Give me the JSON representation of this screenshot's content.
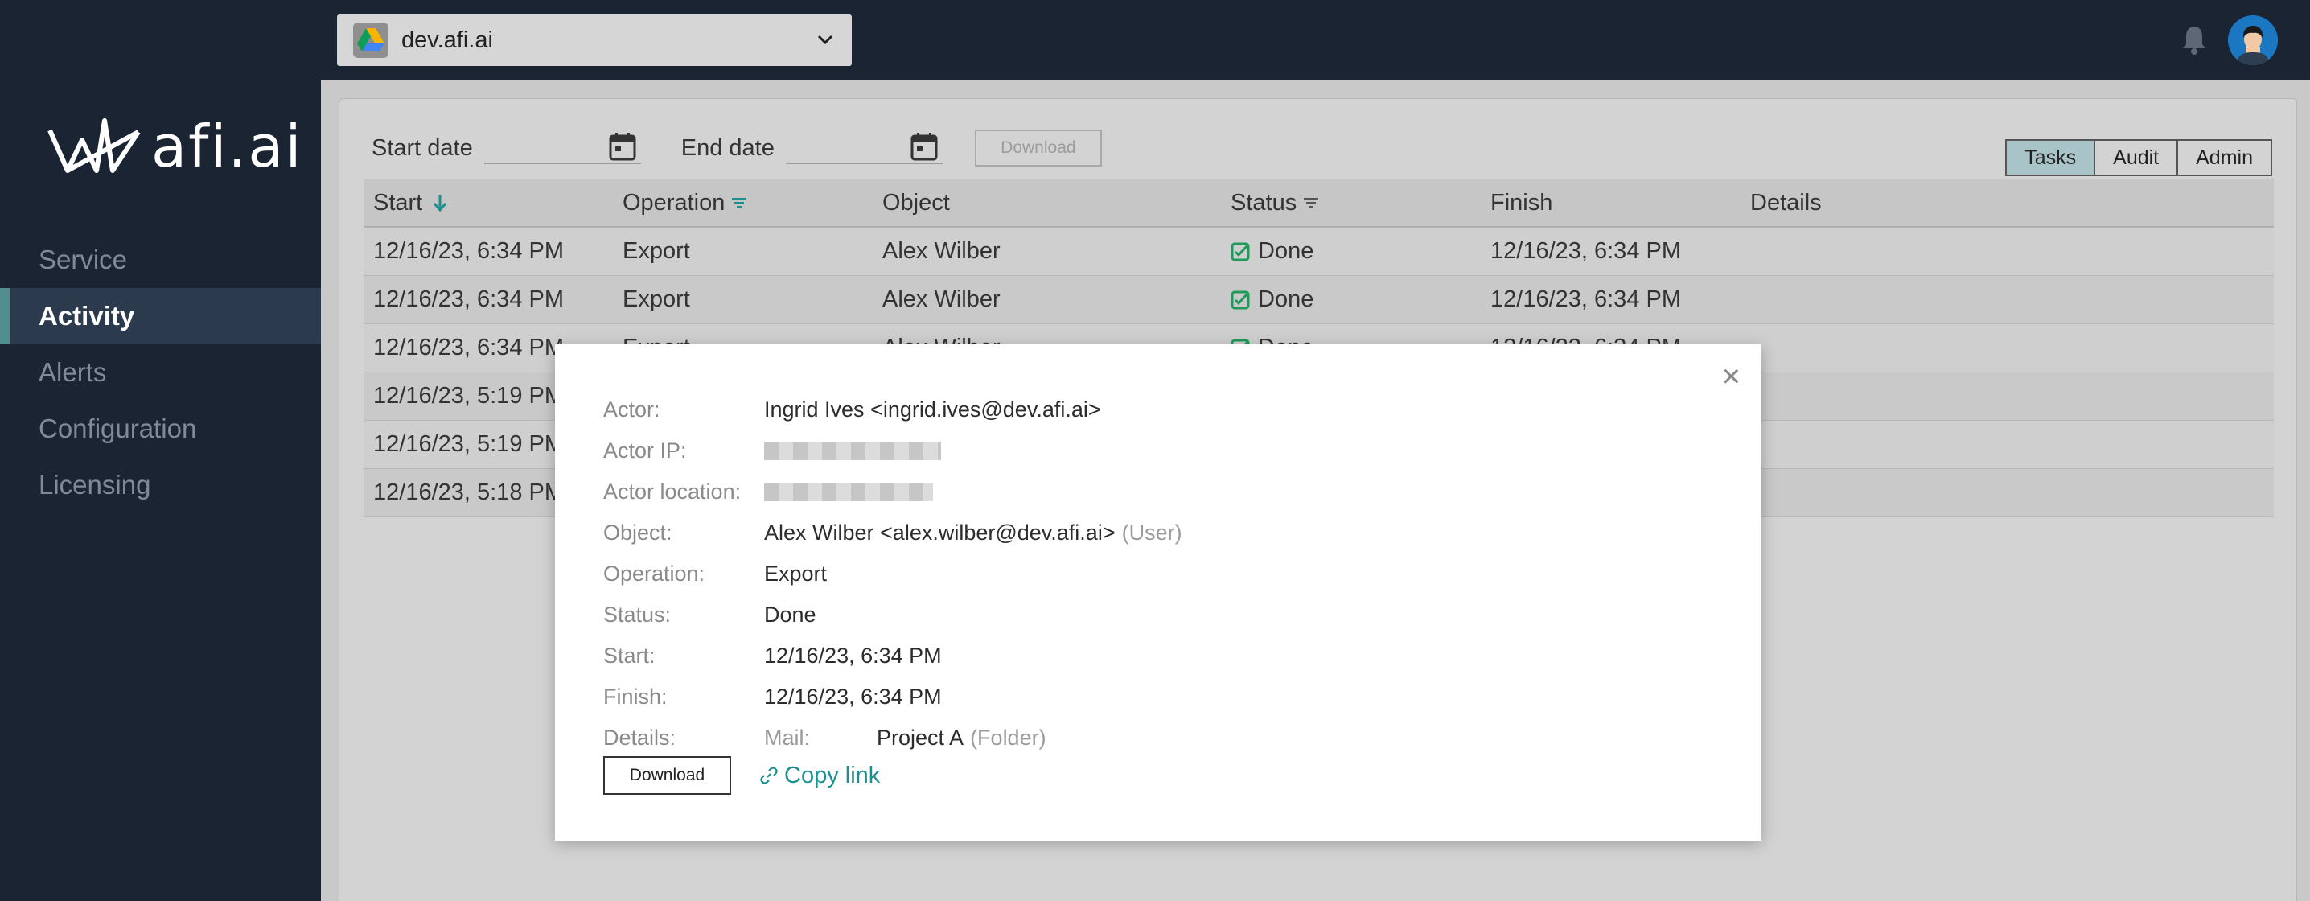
{
  "topbar": {
    "tenant_name": "dev.afi.ai"
  },
  "sidebar": {
    "logo_text": "afi.ai",
    "items": [
      {
        "label": "Service"
      },
      {
        "label": "Activity"
      },
      {
        "label": "Alerts"
      },
      {
        "label": "Configuration"
      },
      {
        "label": "Licensing"
      }
    ]
  },
  "filters": {
    "start_label": "Start date",
    "end_label": "End date",
    "download_label": "Download"
  },
  "view_tabs": [
    {
      "label": "Tasks"
    },
    {
      "label": "Audit"
    },
    {
      "label": "Admin"
    }
  ],
  "table": {
    "headers": [
      "Start",
      "Operation",
      "Object",
      "Status",
      "Finish",
      "Details"
    ],
    "rows": [
      {
        "start": "12/16/23, 6:34 PM",
        "operation": "Export",
        "object": "Alex Wilber",
        "status": "Done",
        "finish": "12/16/23, 6:34 PM"
      },
      {
        "start": "12/16/23, 6:34 PM",
        "operation": "Export",
        "object": "Alex Wilber",
        "status": "Done",
        "finish": "12/16/23, 6:34 PM"
      },
      {
        "start": "12/16/23, 6:34 PM",
        "operation": "Export",
        "object": "Alex Wilber",
        "status": "Done",
        "finish": "12/16/23, 6:34 PM"
      },
      {
        "start": "12/16/23, 5:19 PM",
        "operation": "",
        "object": "",
        "status": "",
        "finish": ""
      },
      {
        "start": "12/16/23, 5:19 PM",
        "operation": "",
        "object": "",
        "status": "",
        "finish": ""
      },
      {
        "start": "12/16/23, 5:18 PM",
        "operation": "",
        "object": "",
        "status": "",
        "finish": ""
      }
    ]
  },
  "modal": {
    "actor_label": "Actor:",
    "actor_value": "Ingrid Ives <ingrid.ives@dev.afi.ai>",
    "actor_ip_label": "Actor IP:",
    "actor_location_label": "Actor location:",
    "object_label": "Object:",
    "object_value": "Alex Wilber <alex.wilber@dev.afi.ai>",
    "object_type": "(User)",
    "operation_label": "Operation:",
    "operation_value": "Export",
    "status_label": "Status:",
    "status_value": "Done",
    "start_label": "Start:",
    "start_value": "12/16/23, 6:34 PM",
    "finish_label": "Finish:",
    "finish_value": "12/16/23, 6:34 PM",
    "details_label": "Details:",
    "details_sub_label": "Mail:",
    "details_value": "Project A",
    "details_type": "(Folder)",
    "download_label": "Download",
    "copy_link_label": "Copy link"
  },
  "colors": {
    "sidebar_bg": "#1b2433",
    "active_accent": "#4f8d8f",
    "link": "#1d8f8f",
    "done_check": "#1f9a5a"
  }
}
